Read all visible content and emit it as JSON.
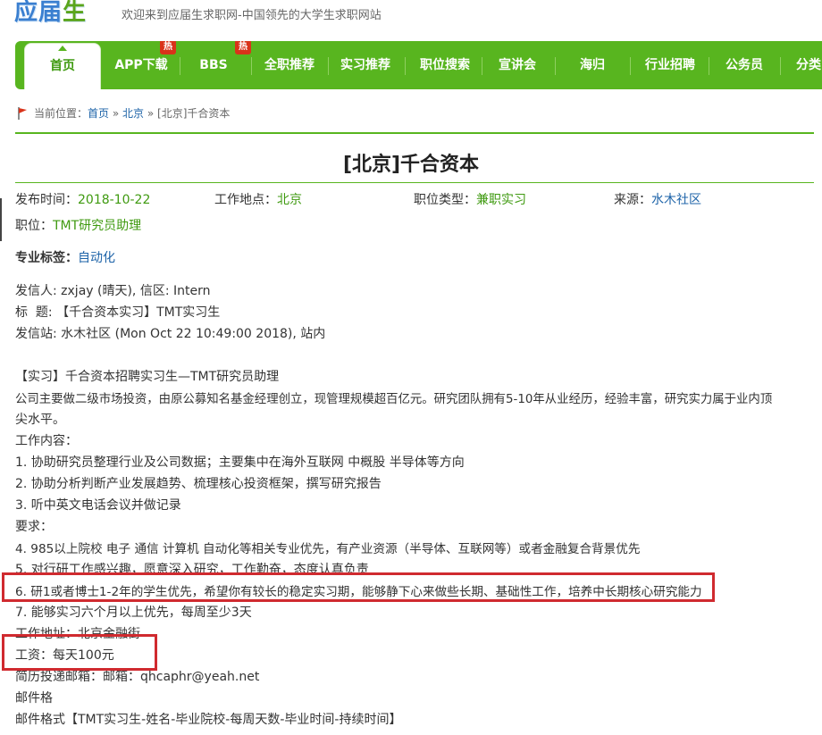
{
  "header": {
    "logo_part1": "应届",
    "logo_part2": "生",
    "welcome": "欢迎来到应届生求职网-中国领先的大学生求职网站"
  },
  "nav": {
    "items": [
      {
        "label": "首页"
      },
      {
        "label": "APP下载",
        "badge": "热"
      },
      {
        "label": "BBS",
        "badge": "热"
      },
      {
        "label": "全职推荐"
      },
      {
        "label": "实习推荐"
      },
      {
        "label": "职位搜索"
      },
      {
        "label": "宣讲会"
      },
      {
        "label": "海归"
      },
      {
        "label": "行业招聘"
      },
      {
        "label": "公务员"
      },
      {
        "label": "分类"
      }
    ]
  },
  "breadcrumb": {
    "prefix": "当前位置：",
    "home": "首页",
    "sep1": " » ",
    "city": "北京",
    "sep2": " » ",
    "current": "[北京]千合资本"
  },
  "article": {
    "title": "[北京]千合资本",
    "publish_label": "发布时间：",
    "publish_value": "2018-10-22",
    "location_label": "工作地点：",
    "location_value": "北京",
    "type_label": "职位类型：",
    "type_value": "兼职实习",
    "source_label": "来源：",
    "source_value": "水木社区",
    "position_label": "职位：",
    "position_value": "TMT研究员助理",
    "tag_label": "专业标签：",
    "tag_value": "自动化",
    "body": [
      "发信人: zxjay (晴天), 信区: Intern",
      "标  题: 【千合资本实习】TMT实习生",
      "发信站: 水木社区 (Mon Oct 22 10:49:00 2018), 站内",
      "【实习】千合资本招聘实习生—TMT研究员助理",
      "公司主要做二级市场投资，由原公募知名基金经理创立，现管理规模超百亿元。研究团队拥有5-10年从业经历，经验丰富，研究实力属于业内顶",
      "尖水平。",
      "工作内容：",
      "1. 协助研究员整理行业及公司数据；主要集中在海外互联网 中概股 半导体等方向",
      "2. 协助分析判断产业发展趋势、梳理核心投资框架，撰写研究报告",
      "3. 听中英文电话会议并做记录",
      "要求：",
      "4. 985以上院校 电子 通信 计算机 自动化等相关专业优先，有产业资源（半导体、互联网等）或者金融复合背景优先",
      "5. 对行研工作感兴趣，愿意深入研究，工作勤奋，态度认真负责",
      "6. 研1或者博士1-2年的学生优先，希望你有较长的稳定实习期，能够静下心来做些长期、基础性工作，培养中长期核心研究能力",
      "7. 能够实习六个月以上优先，每周至少3天",
      "工作地址：北京金融街",
      "工资：每天100元",
      "简历投递邮箱：邮箱：qhcaphr@yeah.net",
      "邮件格",
      "邮件格式【TMT实习生-姓名-毕业院校-每周天数-毕业时间-持续时间】"
    ]
  },
  "colors": {
    "nav_green": "#58b51f",
    "link_blue": "#1d63a8",
    "value_green": "#3f9a10",
    "highlight_red": "#d02a2f"
  }
}
